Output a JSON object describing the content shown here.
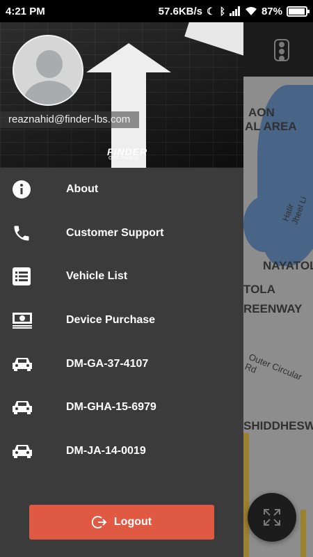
{
  "status_bar": {
    "time": "4:21 PM",
    "network_speed": "57.6KB/s",
    "battery_percent_text": "87%",
    "battery_level": 0.87
  },
  "map": {
    "labels": [
      "AON",
      "AL AREA",
      "NAYATOL",
      "TOLA",
      "REENWAY",
      "SHIDDHESWA",
      "Outer Circular Rd",
      "Hatir Jheel Li"
    ]
  },
  "profile": {
    "email": "reaznahid@finder-lbs.com"
  },
  "brand": {
    "name": "FINDER",
    "tagline": "GPS Tracking"
  },
  "menu": {
    "items": [
      {
        "label": "About",
        "icon": "info-icon"
      },
      {
        "label": "Customer Support",
        "icon": "phone-icon"
      },
      {
        "label": "Vehicle List",
        "icon": "list-icon"
      },
      {
        "label": "Device Purchase",
        "icon": "money-icon"
      },
      {
        "label": "DM-GA-37-4107",
        "icon": "car-icon"
      },
      {
        "label": "DM-GHA-15-6979",
        "icon": "car-icon"
      },
      {
        "label": "DM-JA-14-0019",
        "icon": "car-icon"
      }
    ]
  },
  "logout": {
    "label": "Logout",
    "color": "#e05943"
  },
  "colors": {
    "drawer_bg": "#3b3b3b",
    "map_bg": "#d9d9d9",
    "lake": "#6f9bd1"
  }
}
